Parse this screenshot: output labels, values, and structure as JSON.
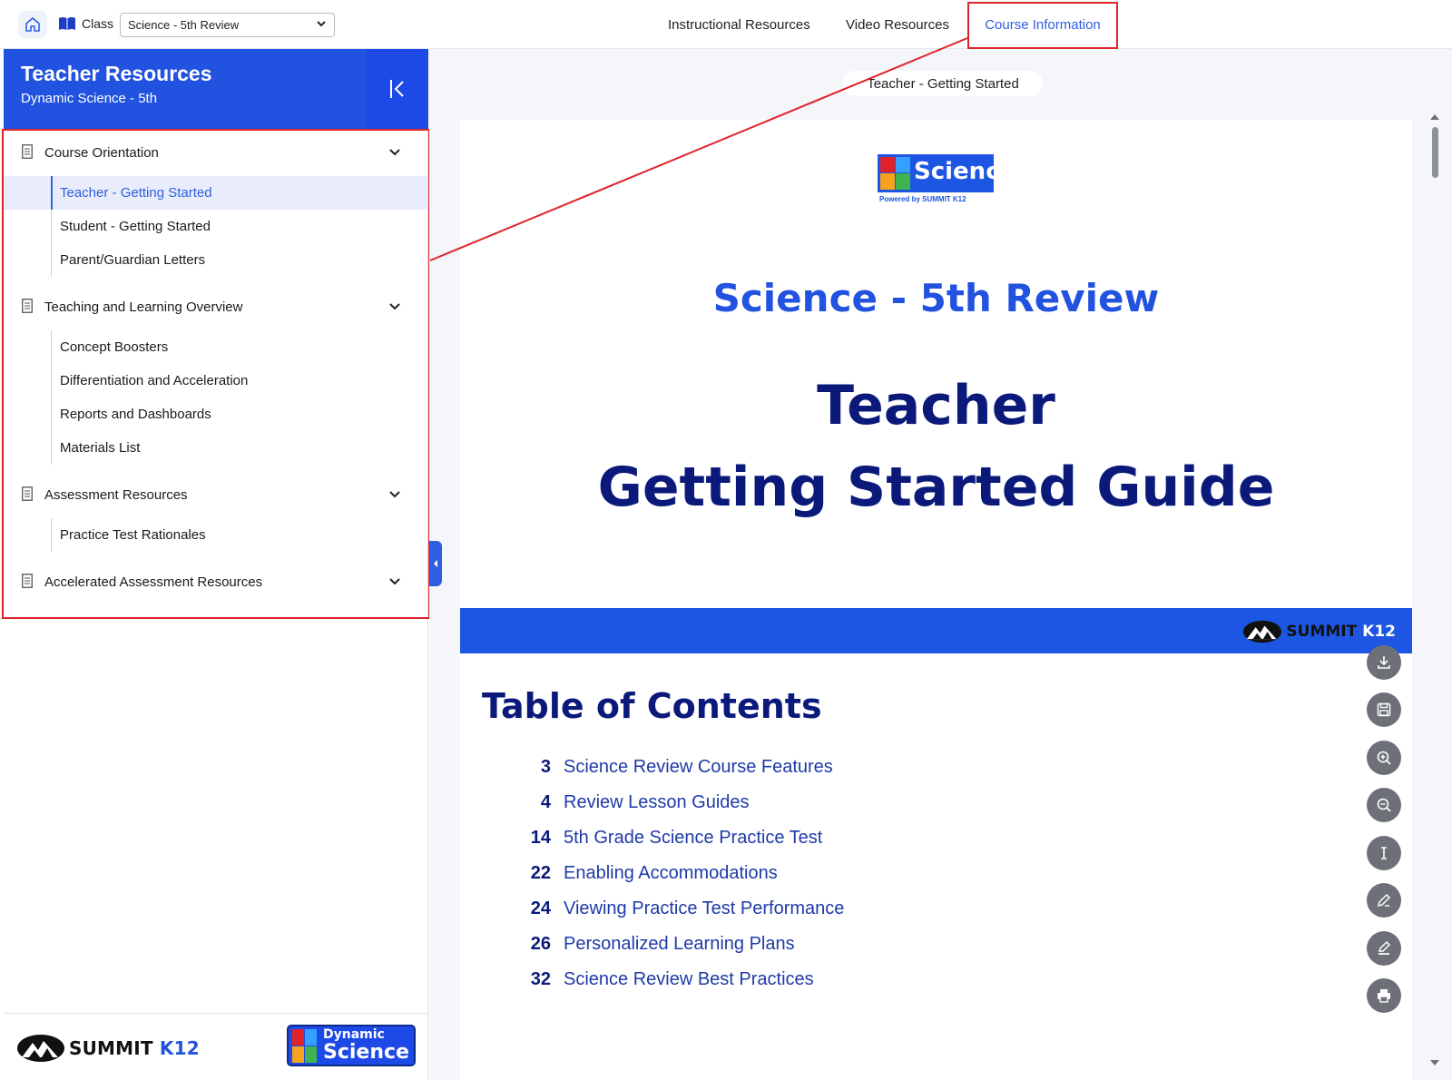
{
  "topbar": {
    "class_label": "Class",
    "class_value": "Science - 5th Review",
    "nav": [
      {
        "label": "Instructional Resources"
      },
      {
        "label": "Video Resources"
      },
      {
        "label": "Course Information"
      }
    ],
    "active_nav": "Course Information"
  },
  "sidebar": {
    "title": "Teacher Resources",
    "subtitle": "Dynamic Science - 5th",
    "sections": [
      {
        "label": "Course Orientation",
        "items": [
          "Teacher - Getting Started",
          "Student - Getting Started",
          "Parent/Guardian Letters"
        ]
      },
      {
        "label": "Teaching and Learning Overview",
        "items": [
          "Concept Boosters",
          "Differentiation and Acceleration",
          "Reports and Dashboards",
          "Materials List"
        ]
      },
      {
        "label": "Assessment Resources",
        "items": [
          "Practice Test Rationales"
        ]
      },
      {
        "label": "Accelerated Assessment Resources",
        "items": []
      }
    ],
    "active_item": "Teacher - Getting Started",
    "footer": {
      "summit_logo_text": "SUMMIT",
      "summit_logo_k12": "K12",
      "ds_logo_top": "Dynamic",
      "ds_logo_bottom": "Science"
    }
  },
  "document": {
    "title": "Teacher - Getting Started",
    "logo_text": "Science",
    "logo_powered": "Powered by SUMMIT K12",
    "course": "Science - 5th Review",
    "heading_line1": "Teacher",
    "heading_line2": "Getting Started Guide",
    "band_logo_text": "SUMMIT",
    "band_logo_k12": "K12",
    "toc_title": "Table of Contents",
    "toc": [
      {
        "page": "3",
        "title": "Science Review Course Features"
      },
      {
        "page": "4",
        "title": "Review Lesson Guides"
      },
      {
        "page": "14",
        "title": "5th Grade Science Practice Test"
      },
      {
        "page": "22",
        "title": "Enabling Accommodations"
      },
      {
        "page": "24",
        "title": "Viewing Practice Test Performance"
      },
      {
        "page": "26",
        "title": "Personalized Learning Plans"
      },
      {
        "page": "32",
        "title": "Science Review Best Practices"
      }
    ]
  },
  "tools": [
    "download-icon",
    "save-icon",
    "zoom-in-icon",
    "zoom-out-icon",
    "text-cursor-icon",
    "pen-icon",
    "highlight-icon",
    "print-icon"
  ],
  "colors": {
    "brand_blue": "#2152e0",
    "navy": "#0b1a7a",
    "annotation_red": "#e0222a",
    "active_text": "#2f5fe0"
  }
}
